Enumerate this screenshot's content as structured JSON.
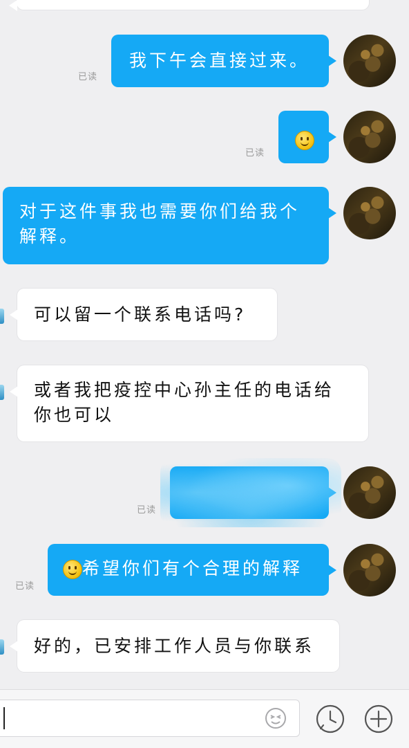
{
  "messages": [
    {
      "id": "m1",
      "direction": "sent",
      "text": "我下午会直接过来。",
      "read_label": "已读"
    },
    {
      "id": "m2",
      "direction": "sent",
      "emoji": "smiley-emoji",
      "read_label": "已读"
    },
    {
      "id": "m3",
      "direction": "sent",
      "lines": [
        "对于这件事我也需要你们给我个",
        "解释。"
      ]
    },
    {
      "id": "m4",
      "direction": "received",
      "text": "可以留一个联系电话吗?"
    },
    {
      "id": "m5",
      "direction": "received",
      "lines": [
        "或者我把疫控中心孙主任的电话给",
        "你也可以"
      ]
    },
    {
      "id": "m6",
      "direction": "sent",
      "redacted": true,
      "read_label": "已读"
    },
    {
      "id": "m7",
      "direction": "sent",
      "emoji": "smiley-emoji",
      "text": "希望你们有个合理的解释",
      "read_label": "已读"
    },
    {
      "id": "m8",
      "direction": "received",
      "text": "好的，已安排工作人员与你联系"
    }
  ],
  "composer": {
    "input_value": "",
    "icons": [
      "emoji-icon",
      "history-clock-icon",
      "add-plus-icon"
    ]
  },
  "colors": {
    "sent_bubble": "#15a9f5",
    "received_bubble": "#ffffff",
    "background": "#efeff1",
    "read_text": "#9a9a9a"
  }
}
